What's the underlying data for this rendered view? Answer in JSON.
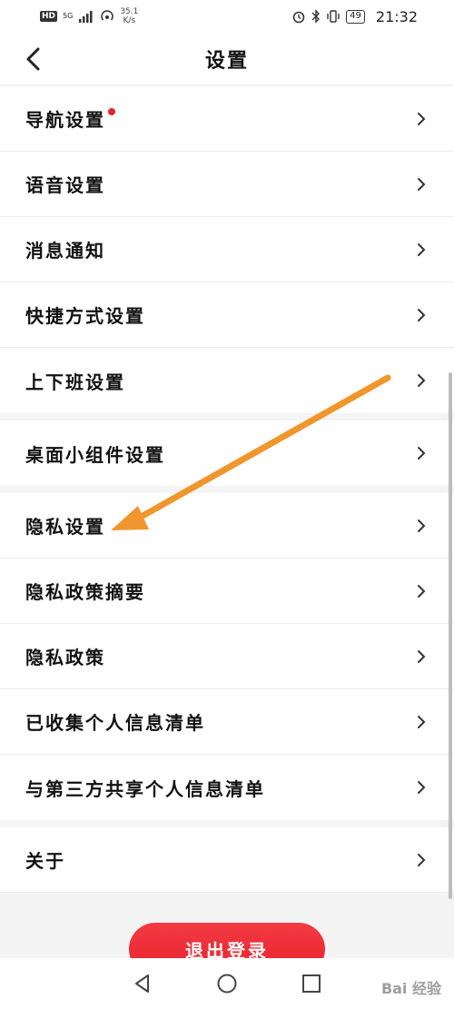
{
  "status_bar": {
    "hd": "HD",
    "net": "5G",
    "speed_value": "35.1",
    "speed_unit": "K/s",
    "battery": "49",
    "time": "21:32"
  },
  "header": {
    "title": "设置"
  },
  "settings": {
    "items": [
      {
        "label": "导航设置"
      },
      {
        "label": "语音设置"
      },
      {
        "label": "消息通知"
      },
      {
        "label": "快捷方式设置"
      },
      {
        "label": "上下班设置"
      },
      {
        "label": "桌面小组件设置"
      },
      {
        "label": "隐私设置"
      },
      {
        "label": "隐私政策摘要"
      },
      {
        "label": "隐私政策"
      },
      {
        "label": "已收集个人信息清单"
      },
      {
        "label": "与第三方共享个人信息清单"
      },
      {
        "label": "关于"
      }
    ]
  },
  "logout_label": "退出登录",
  "watermark": "Bai 经验",
  "colors": {
    "accent": "#e9222c",
    "annotation_arrow": "#f0962e"
  },
  "icons": [
    "back-icon",
    "chevron-right-icon",
    "nav-back-icon",
    "nav-home-icon",
    "nav-recent-icon"
  ]
}
